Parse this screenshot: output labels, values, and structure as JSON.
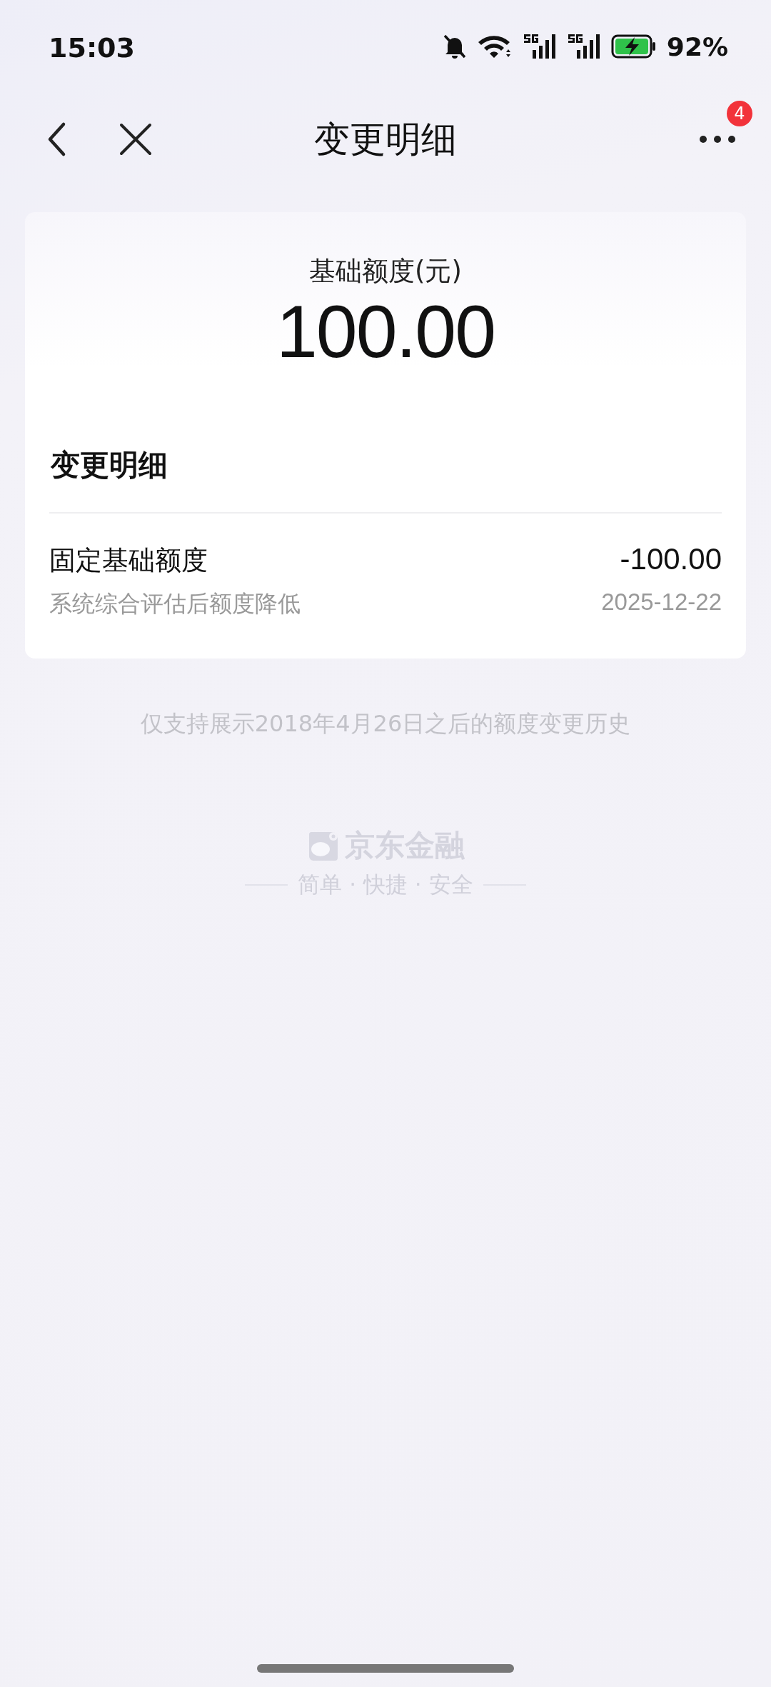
{
  "status_bar": {
    "time": "15:03",
    "battery": "92%"
  },
  "nav": {
    "title": "变更明细",
    "badge": "4"
  },
  "summary": {
    "label": "基础额度(元)",
    "amount": "100.00"
  },
  "details": {
    "heading": "变更明细",
    "items": [
      {
        "title": "固定基础额度",
        "amount": "-100.00",
        "reason": "系统综合评估后额度降低",
        "date": "2025-12-22"
      }
    ]
  },
  "note": "仅支持展示2018年4月26日之后的额度变更历史",
  "footer": {
    "brand": "京东金融",
    "slogan": "简单 · 快捷 · 安全"
  }
}
